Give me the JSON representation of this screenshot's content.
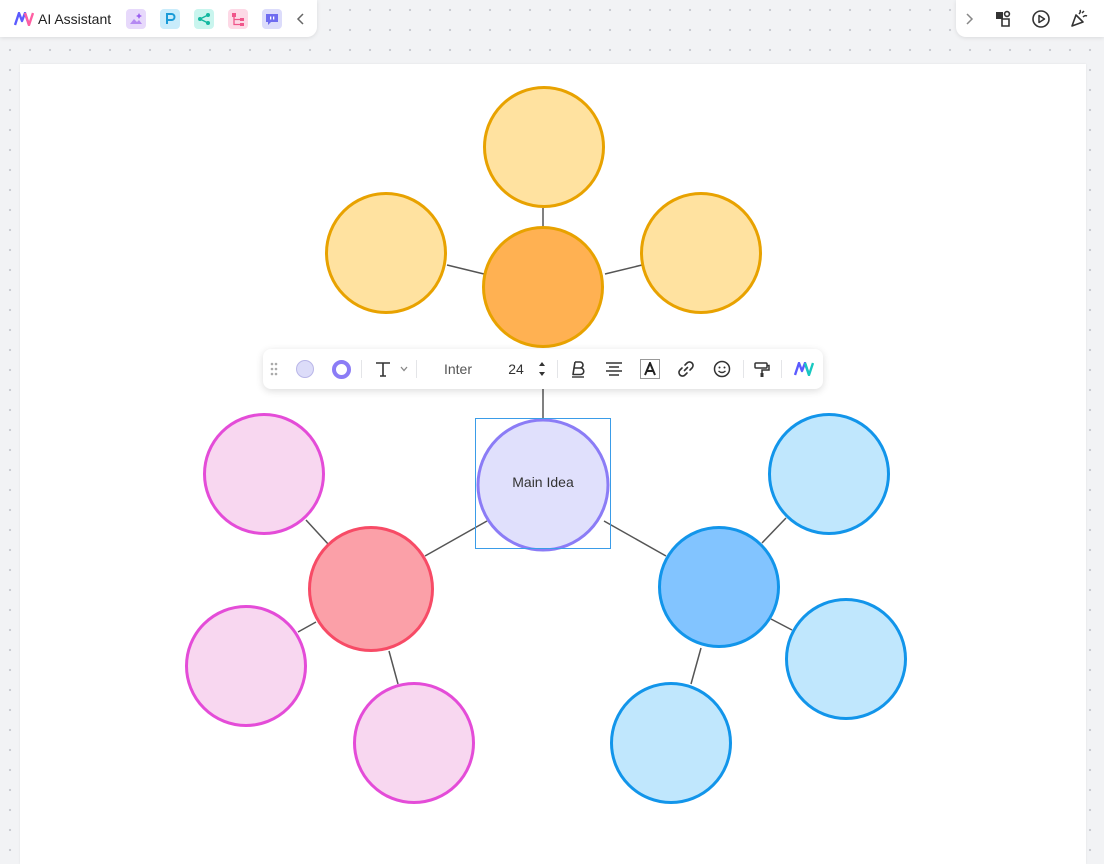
{
  "toolbar": {
    "brand_label": "AI Assistant",
    "tools": [
      {
        "name": "ai-image-icon",
        "color": "#e7d9fb"
      },
      {
        "name": "ai-presentation-icon",
        "color": "#c9ecfb"
      },
      {
        "name": "ai-mindmap-icon",
        "color": "#c9f5ee"
      },
      {
        "name": "ai-flowchart-icon",
        "color": "#fdd9e6"
      },
      {
        "name": "ai-chat-icon",
        "color": "#dcdcfb"
      }
    ]
  },
  "format_bar": {
    "fill_color": "#dcdcf9",
    "border_color": "#8b7cf6",
    "font_family": "Inter",
    "font_size": "24"
  },
  "mindmap": {
    "center_label": "Main Idea",
    "colors": {
      "center_fill": "#e0e0fc",
      "center_stroke": "#8b7cf6",
      "orange_hub_fill": "#ffb152",
      "orange_stroke": "#e8a200",
      "orange_leaf_fill": "#ffe2a0",
      "red_hub_fill": "#fba0a8",
      "red_stroke": "#f74b66",
      "pink_leaf_fill": "#f8d7f0",
      "pink_stroke": "#e44cd8",
      "blue_hub_fill": "#82c4ff",
      "blue_stroke": "#1295ea",
      "blue_leaf_fill": "#c0e7fd"
    }
  }
}
